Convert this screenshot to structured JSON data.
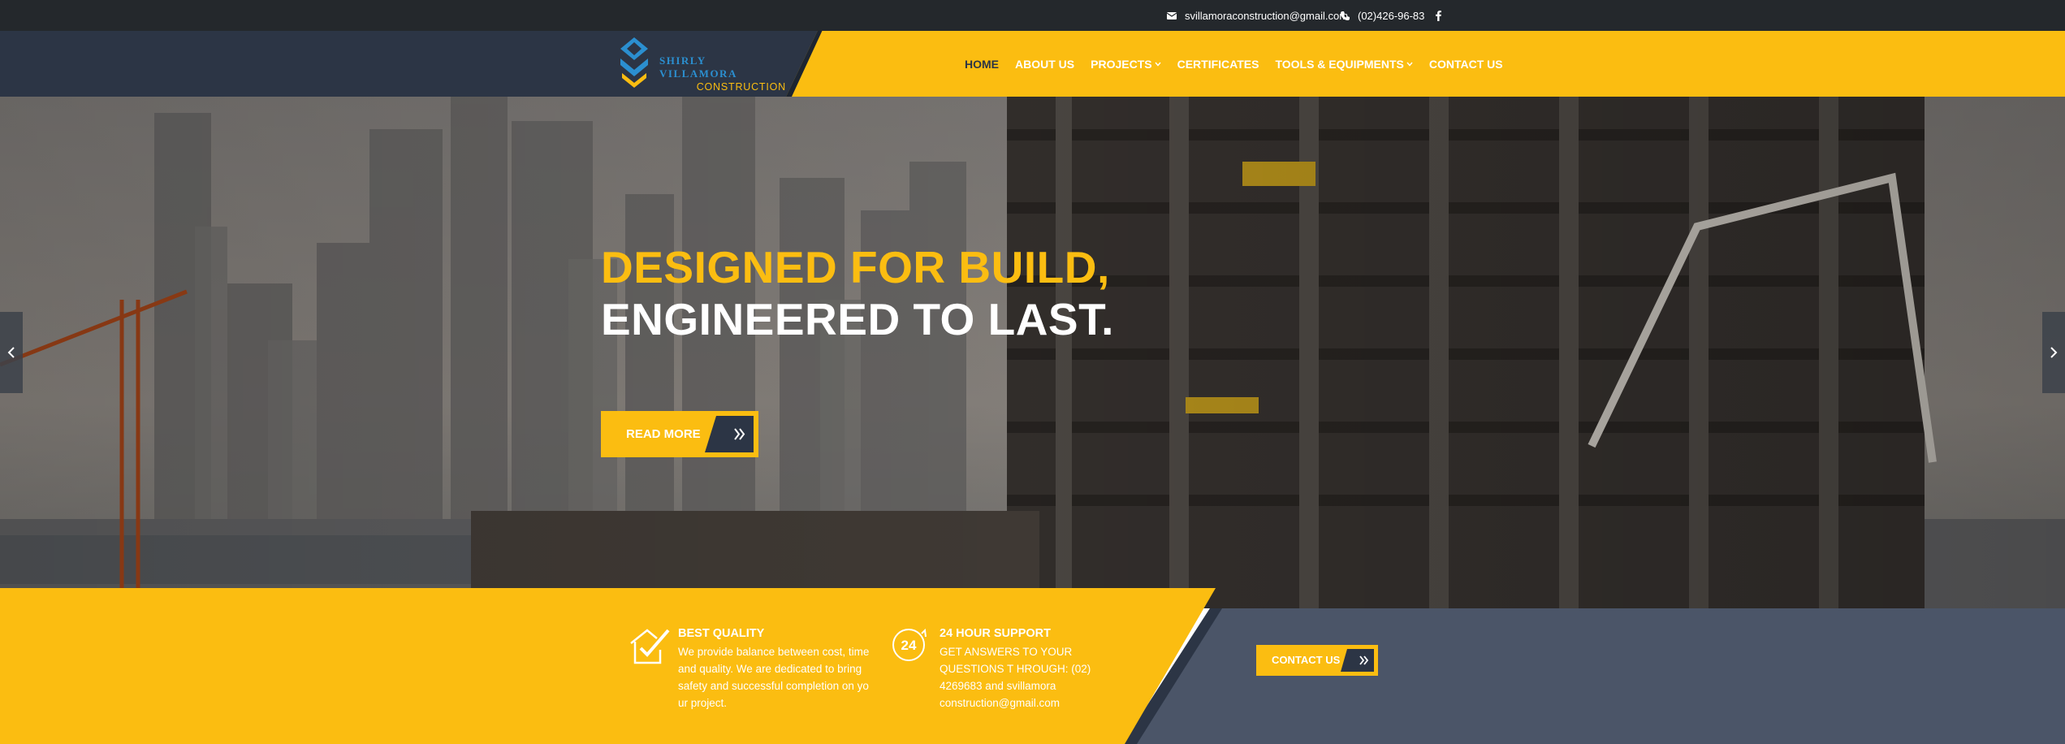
{
  "topbar": {
    "email": "svillamoraconstruction@gmail.com",
    "phone": "(02)426-96-83",
    "email_icon": "envelope-icon",
    "phone_icon": "phone-icon",
    "social_icon": "facebook-icon"
  },
  "logo": {
    "name": "SHIRLY VILLAMORA",
    "subtitle": "CONSTRUCTION"
  },
  "nav": {
    "items": [
      {
        "label": "HOME",
        "active": true
      },
      {
        "label": "ABOUT US"
      },
      {
        "label": "PROJECTS",
        "dropdown": true
      },
      {
        "label": "CERTIFICATES"
      },
      {
        "label": "TOOLS & EQUIPMENTS",
        "dropdown": true
      },
      {
        "label": "CONTACT US"
      }
    ]
  },
  "hero": {
    "title_line1": "DESIGNED FOR BUILD,",
    "title_line2": "ENGINEERED TO LAST.",
    "button_label": "READ MORE",
    "prev_icon": "chevron-left-icon",
    "next_icon": "chevron-right-icon"
  },
  "features": {
    "quality": {
      "title": "BEST QUALITY",
      "text": "We provide balance between cost, time and quality. We are dedicated to bring safety and successful completion on yo ur project.",
      "icon": "check-house-icon"
    },
    "support": {
      "title": "24 HOUR SUPPORT",
      "text": "GET ANSWERS TO YOUR QUESTIONS T HROUGH: (02) 4269683 and svillamora construction@gmail.com",
      "icon": "24-hour-icon",
      "icon_text": "24"
    },
    "contact_button": "CONTACT US"
  },
  "colors": {
    "accent": "#fbbd11",
    "navy": "#2c3545",
    "topbar": "#24282c"
  }
}
